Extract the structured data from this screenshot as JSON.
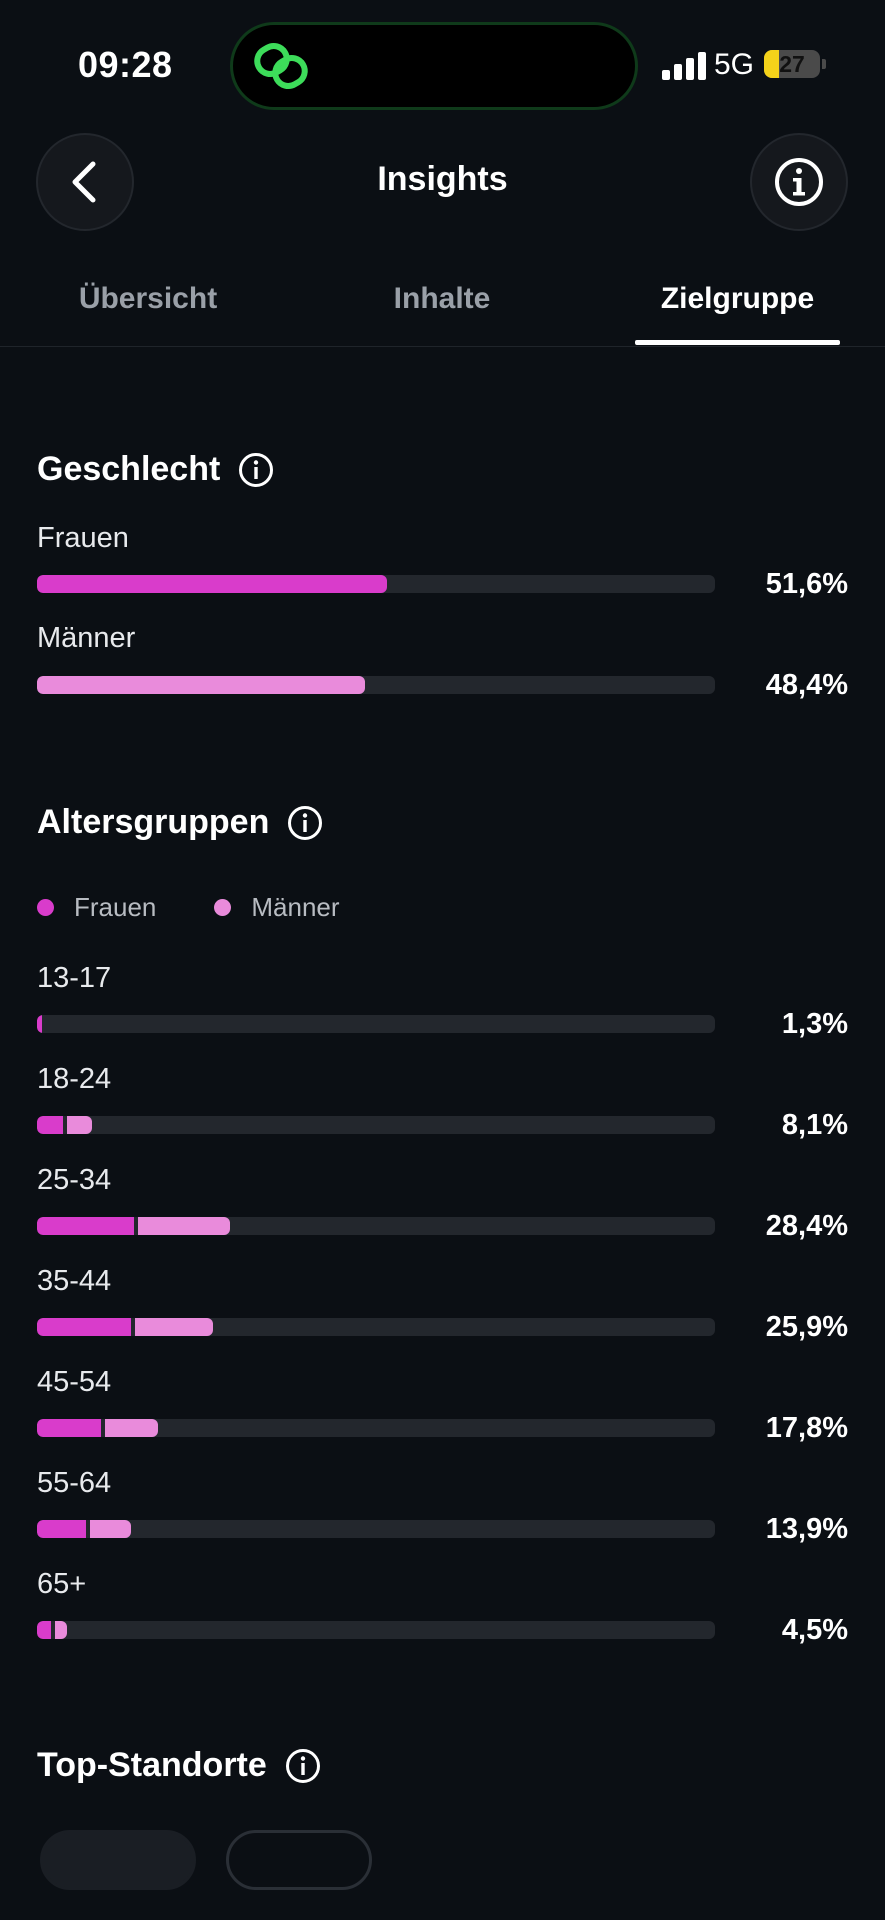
{
  "status_bar": {
    "time": "09:28",
    "network": "5G",
    "battery": "27",
    "battery_percent": 27,
    "island_icon": "link-icon"
  },
  "header": {
    "title": "Insights",
    "back_icon": "chevron-left-icon",
    "info_icon": "info-icon"
  },
  "tabs": [
    {
      "label": "Übersicht",
      "active": false
    },
    {
      "label": "Inhalte",
      "active": false
    },
    {
      "label": "Zielgruppe",
      "active": true
    }
  ],
  "gender": {
    "title": "Geschlecht",
    "rows": [
      {
        "label": "Frauen",
        "value": "51,6%",
        "fraction": 0.516,
        "color": "#d93ccb"
      },
      {
        "label": "Männer",
        "value": "48,4%",
        "fraction": 0.484,
        "color": "#e98bdb"
      }
    ]
  },
  "age": {
    "title": "Altersgruppen",
    "legend": [
      {
        "label": "Frauen",
        "color": "#d93ccb"
      },
      {
        "label": "Männer",
        "color": "#e98bdb"
      }
    ],
    "rows": [
      {
        "label": "13-17",
        "value": "1,3%",
        "women": 0.008,
        "men": 0.005
      },
      {
        "label": "18-24",
        "value": "8,1%",
        "women": 0.038,
        "men": 0.043
      },
      {
        "label": "25-34",
        "value": "28,4%",
        "women": 0.143,
        "men": 0.141
      },
      {
        "label": "35-44",
        "value": "25,9%",
        "women": 0.138,
        "men": 0.121
      },
      {
        "label": "45-54",
        "value": "17,8%",
        "women": 0.094,
        "men": 0.084
      },
      {
        "label": "55-64",
        "value": "13,9%",
        "women": 0.072,
        "men": 0.067
      },
      {
        "label": "65+",
        "value": "4,5%",
        "women": 0.02,
        "men": 0.025
      }
    ]
  },
  "locations": {
    "title": "Top-Standorte"
  },
  "colors": {
    "background": "#0b0f14",
    "women": "#d93ccb",
    "men": "#e98bdb",
    "track": "#23272d",
    "battery": "#f4d21a",
    "island_accent": "#3ddc5a"
  }
}
